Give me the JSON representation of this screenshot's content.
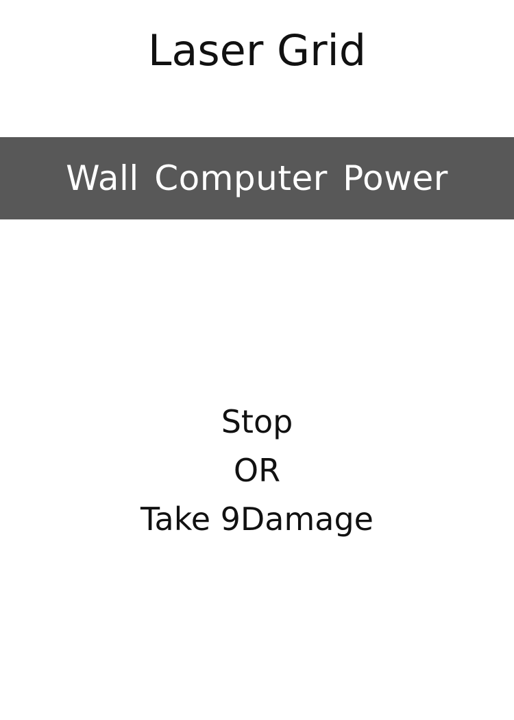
{
  "card": {
    "title": "Laser Grid",
    "banner": "Wall Computer Power",
    "effect_lines": [
      "Stop",
      "OR",
      "Take 9Damage"
    ]
  },
  "colors": {
    "background": "#ffffff",
    "banner_background": "#585858",
    "banner_text": "#ffffff",
    "text": "#111111"
  }
}
